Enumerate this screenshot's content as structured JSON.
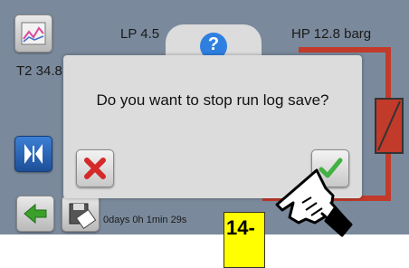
{
  "status": {
    "lp": "LP 4.5",
    "hp": "HP 12.8 barg",
    "t2": "T2 34.8",
    "run_time": "0days 0h 1min 29s"
  },
  "dialog": {
    "icon": "question-icon",
    "icon_glyph": "?",
    "message": "Do you want to stop run log save?",
    "cancel_icon": "cross-icon",
    "confirm_icon": "checkmark-icon"
  },
  "annotation": {
    "step_label": "14-"
  },
  "colors": {
    "screen_bg": "#7a8a9c",
    "dialog_bg": "#dcdcdc",
    "pipe_red": "#c23a2a",
    "question_blue": "#2f7fe0",
    "badge_yellow": "#ffff00",
    "back_green": "#3aa02a"
  }
}
